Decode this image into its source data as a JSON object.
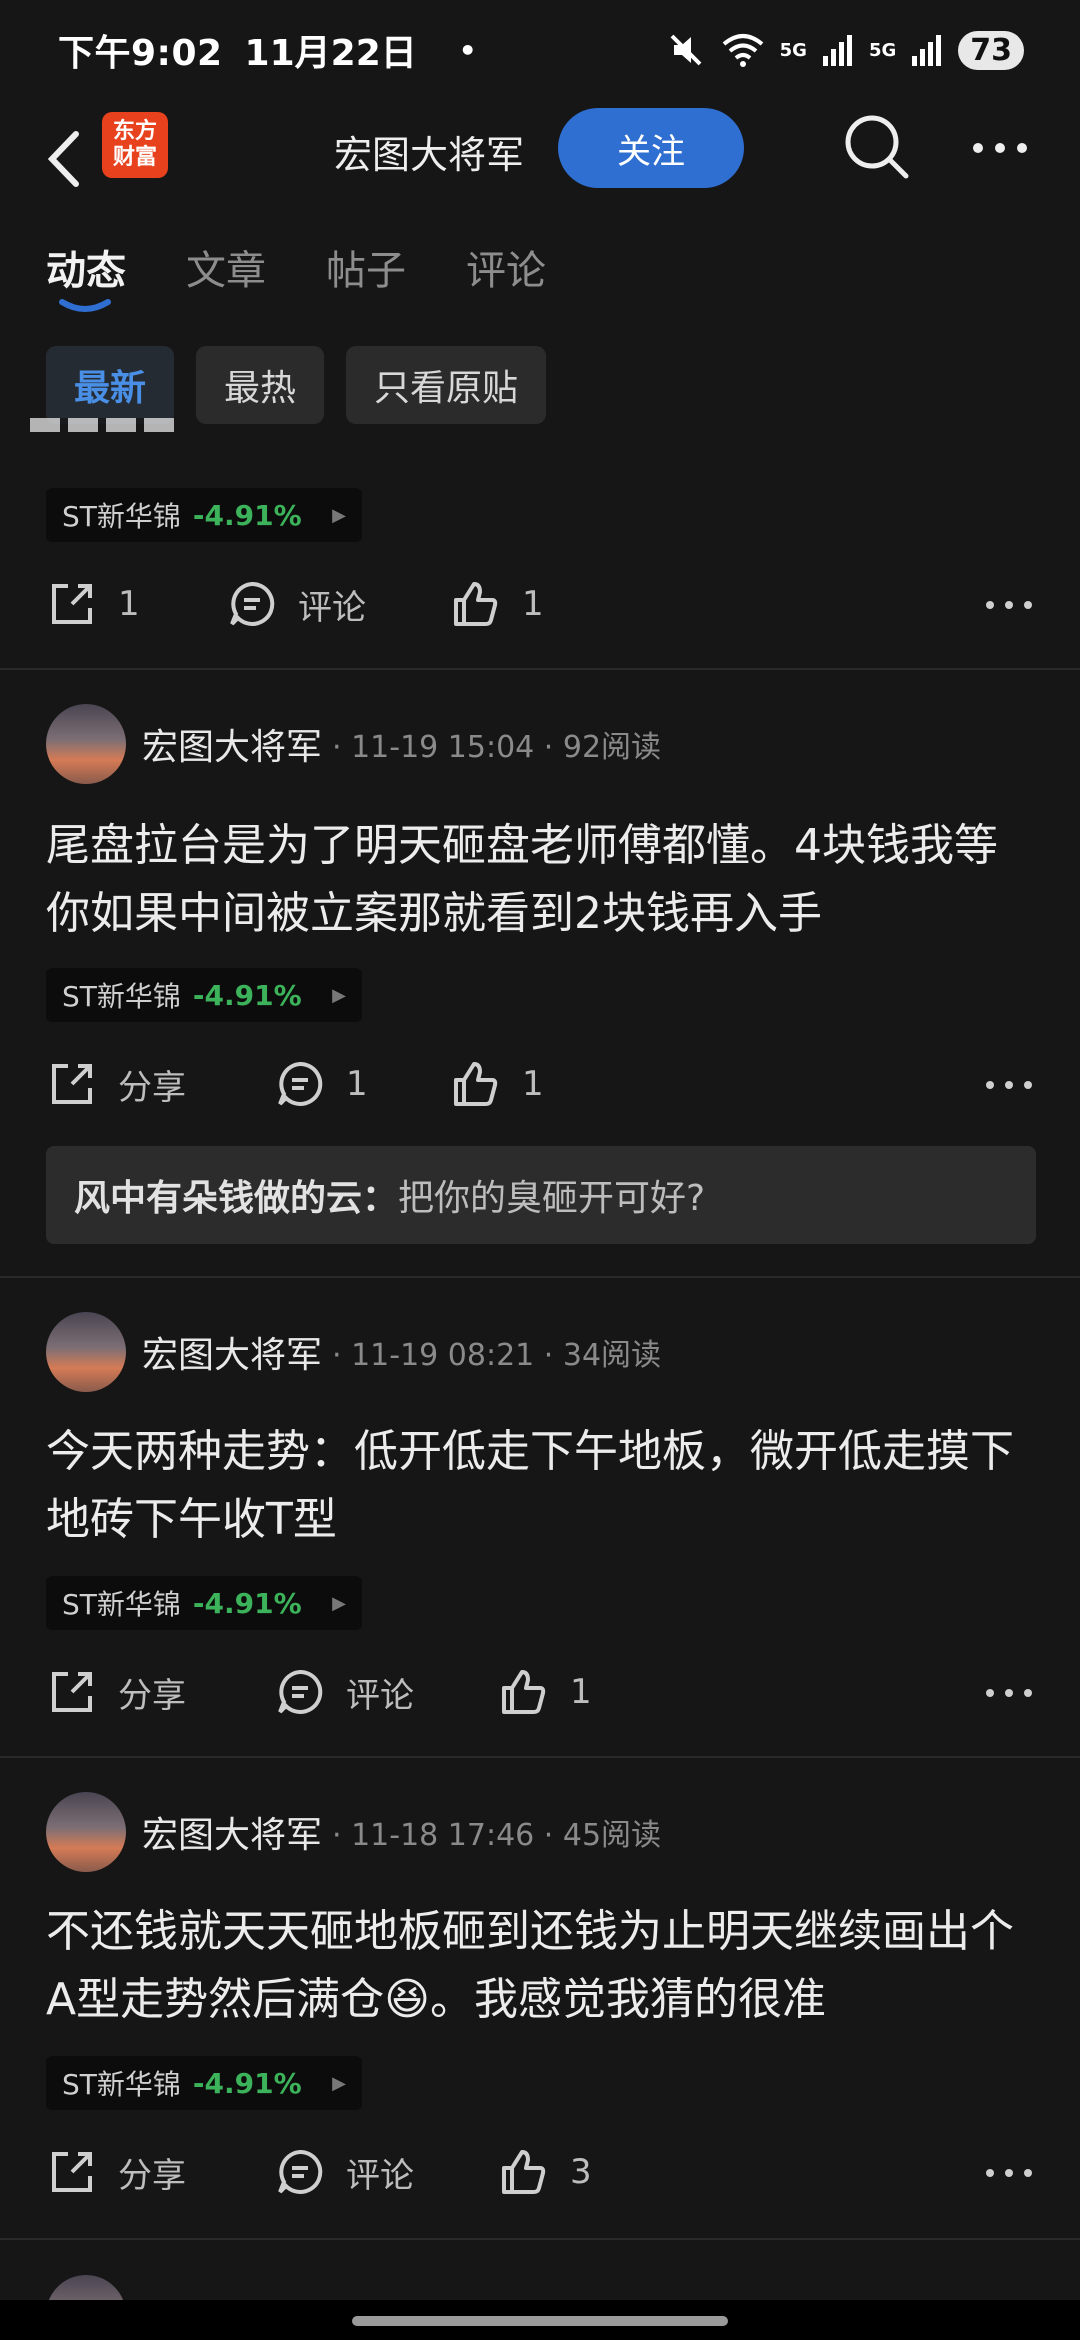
{
  "status_bar": {
    "time": "下午9:02",
    "date": "11月22日",
    "dot": "•",
    "battery": "73",
    "net_label": "5G"
  },
  "header": {
    "logo_line1": "东方",
    "logo_line2": "财富",
    "title": "宏图大将军",
    "follow_label": "关注"
  },
  "tabs": [
    "动态",
    "文章",
    "帖子",
    "评论"
  ],
  "filters": [
    "最新",
    "最热",
    "只看原贴"
  ],
  "stock": {
    "name": "ST新华锦",
    "change": "-4.91%"
  },
  "first_card": {
    "share_count": "1",
    "comment_label": "评论",
    "like_count": "1"
  },
  "posts": [
    {
      "author": "宏图大将军",
      "meta": "· 11-19 15:04 · 92阅读",
      "text": "尾盘拉台是为了明天砸盘老师傅都懂。4块钱我等你如果中间被立案那就看到2块钱再入手",
      "share_label": "分享",
      "comment_count": "1",
      "like_count": "1",
      "reply_user": "风中有朵钱做的云：",
      "reply_text": "把你的臭砸开可好?"
    },
    {
      "author": "宏图大将军",
      "meta": "· 11-19 08:21 · 34阅读",
      "text": "今天两种走势：低开低走下午地板，微开低走摸下地砖下午收T型",
      "share_label": "分享",
      "comment_label": "评论",
      "like_count": "1"
    },
    {
      "author": "宏图大将军",
      "meta": "· 11-18 17:46 · 45阅读",
      "text": "不还钱就天天砸地板砸到还钱为止明天继续画出个A型走势然后满仓😆。我感觉我猜的很准",
      "share_label": "分享",
      "comment_label": "评论",
      "like_count": "3"
    }
  ]
}
